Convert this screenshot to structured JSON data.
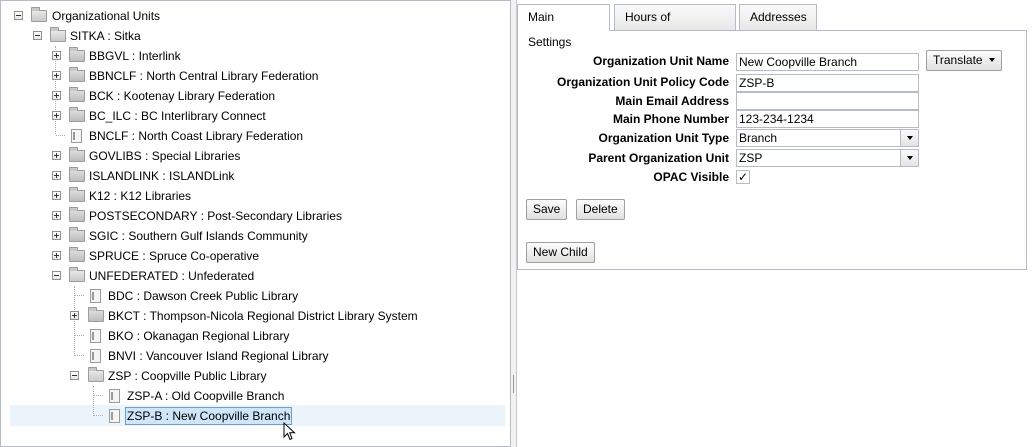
{
  "tree": {
    "root": {
      "label": "Organizational Units",
      "expander": "-",
      "icon": "folder-open-icon"
    },
    "sitka": {
      "label": "SITKA : Sitka",
      "expander": "-",
      "icon": "folder-open-icon"
    },
    "level2": [
      {
        "label": "BBGVL : Interlink",
        "expander": "+",
        "icon": "folder-icon"
      },
      {
        "label": "BBNCLF : North Central Library Federation",
        "expander": "+",
        "icon": "folder-icon"
      },
      {
        "label": "BCK : Kootenay Library Federation",
        "expander": "+",
        "icon": "folder-icon"
      },
      {
        "label": "BC_ILC : BC Interlibrary Connect",
        "expander": "+",
        "icon": "folder-icon"
      },
      {
        "label": "BNCLF : North Coast Library Federation",
        "expander": "",
        "icon": "leaf-icon"
      },
      {
        "label": "GOVLIBS : Special Libraries",
        "expander": "+",
        "icon": "folder-icon"
      },
      {
        "label": "ISLANDLINK : ISLANDLink",
        "expander": "+",
        "icon": "folder-icon"
      },
      {
        "label": "K12 : K12 Libraries",
        "expander": "+",
        "icon": "folder-icon"
      },
      {
        "label": "POSTSECONDARY : Post-Secondary Libraries",
        "expander": "+",
        "icon": "folder-icon"
      },
      {
        "label": "SGIC : Southern Gulf Islands Community",
        "expander": "+",
        "icon": "folder-icon"
      },
      {
        "label": "SPRUCE : Spruce Co-operative",
        "expander": "+",
        "icon": "folder-icon"
      },
      {
        "label": "UNFEDERATED : Unfederated",
        "expander": "-",
        "icon": "folder-open-icon"
      }
    ],
    "level3": [
      {
        "label": "BDC : Dawson Creek Public Library",
        "expander": "",
        "icon": "leaf-icon"
      },
      {
        "label": "BKCT : Thompson-Nicola Regional District Library System",
        "expander": "+",
        "icon": "folder-icon"
      },
      {
        "label": "BKO : Okanagan Regional Library",
        "expander": "",
        "icon": "leaf-icon"
      },
      {
        "label": "BNVI : Vancouver Island Regional Library",
        "expander": "",
        "icon": "leaf-icon"
      },
      {
        "label": "ZSP : Coopville Public Library",
        "expander": "-",
        "icon": "folder-open-icon"
      }
    ],
    "level4": [
      {
        "label": "ZSP-A : Old Coopville Branch",
        "icon": "leaf-icon"
      },
      {
        "label": "ZSP-B : New Coopville Branch",
        "icon": "leaf-icon",
        "selected": true
      }
    ]
  },
  "tabs": [
    {
      "label": "Main Settings",
      "active": true
    },
    {
      "label": "Hours of Operation",
      "active": false
    },
    {
      "label": "Addresses",
      "active": false
    }
  ],
  "form": {
    "name_label": "Organization Unit Name",
    "name_value": "New Coopville Branch",
    "translate_label": "Translate",
    "policy_label": "Organization Unit Policy Code",
    "policy_value": "ZSP-B",
    "email_label": "Main Email Address",
    "email_value": "",
    "phone_label": "Main Phone Number",
    "phone_value": "123-234-1234",
    "type_label": "Organization Unit Type",
    "type_value": "Branch",
    "parent_label": "Parent Organization Unit",
    "parent_value": "ZSP",
    "opac_label": "OPAC Visible",
    "opac_checked": true,
    "opac_mark": "✓",
    "save_label": "Save",
    "delete_label": "Delete",
    "new_child_label": "New Child"
  },
  "icons": {
    "collapse": "collapse-icon",
    "expand": "expand-icon",
    "cursor": "mouse-cursor-icon",
    "dropdown": "chevron-down-icon"
  },
  "colors": {
    "border": "#b5bcc7",
    "selection": "#cfe5fa",
    "selection_border": "#759dc0",
    "row_hover": "#ebf3fb"
  }
}
